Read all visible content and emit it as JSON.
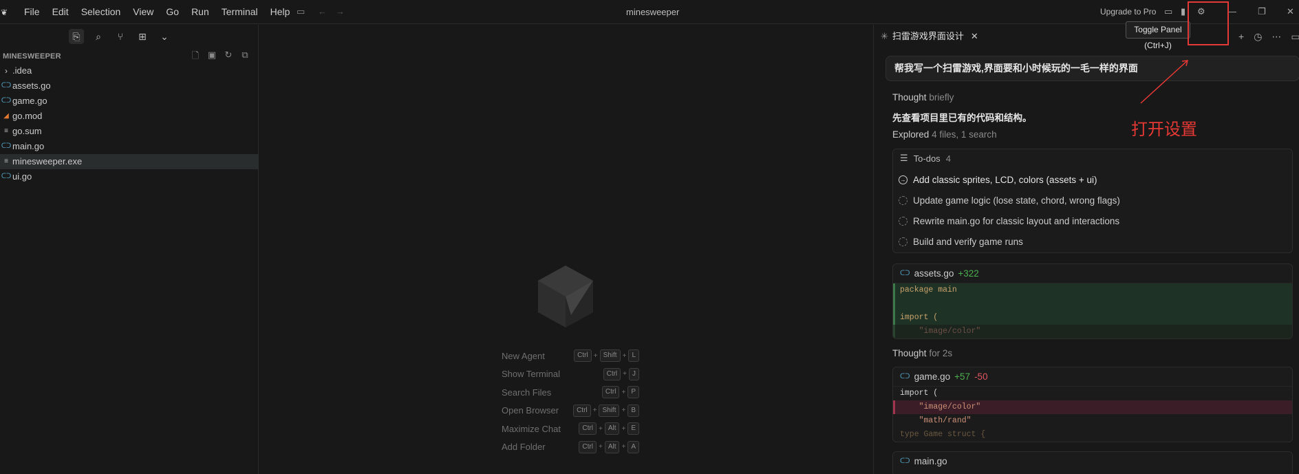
{
  "window_title": "minesweeper",
  "menu": [
    "File",
    "Edit",
    "Selection",
    "View",
    "Go",
    "Run",
    "Terminal",
    "Help"
  ],
  "upgrade_label": "Upgrade to Pro",
  "tooltip": "Toggle Panel (Ctrl+J)",
  "annotation_label": "打开设置",
  "explorer": {
    "title": "MINESWEEPER",
    "files": [
      {
        "name": ".idea",
        "icon": "chevron-right-icon"
      },
      {
        "name": "assets.go",
        "icon": "go-file-icon"
      },
      {
        "name": "game.go",
        "icon": "go-file-icon"
      },
      {
        "name": "go.mod",
        "icon": "go-mod-icon"
      },
      {
        "name": "go.sum",
        "icon": "plain-file-icon"
      },
      {
        "name": "main.go",
        "icon": "go-file-icon"
      },
      {
        "name": "minesweeper.exe",
        "icon": "plain-file-icon",
        "selected": true
      },
      {
        "name": "ui.go",
        "icon": "go-file-icon"
      }
    ]
  },
  "shortcuts": [
    {
      "label": "New Agent",
      "keys": [
        "Ctrl",
        "Shift",
        "L"
      ]
    },
    {
      "label": "Show Terminal",
      "keys": [
        "Ctrl",
        "J"
      ]
    },
    {
      "label": "Search Files",
      "keys": [
        "Ctrl",
        "P"
      ]
    },
    {
      "label": "Open Browser",
      "keys": [
        "Ctrl",
        "Shift",
        "B"
      ]
    },
    {
      "label": "Maximize Chat",
      "keys": [
        "Ctrl",
        "Alt",
        "E"
      ]
    },
    {
      "label": "Add Folder",
      "keys": [
        "Ctrl",
        "Alt",
        "A"
      ]
    }
  ],
  "chat": {
    "tab_title": "扫雷游戏界面设计",
    "prompt": "帮我写一个扫雷游戏,界面要和小时候玩的一毛一样的界面",
    "thought1_label": "Thought",
    "thought1_suffix": "briefly",
    "summary": "先查看项目里已有的代码和结构。",
    "explored_label": "Explored",
    "explored_suffix": "4 files, 1 search",
    "todos_label": "To-dos",
    "todos_count": "4",
    "todos": [
      "Add classic sprites, LCD, colors (assets + ui)",
      "Update game logic (lose state, chord, wrong flags)",
      "Rewrite main.go for classic layout and interactions",
      "Build and verify game runs"
    ],
    "file1": {
      "name": "assets.go",
      "added": "+322"
    },
    "file1_code": {
      "l1_kw": "package",
      "l1_name": "main",
      "l3": "import (",
      "l4": "\"image/color\""
    },
    "thought2_label": "Thought",
    "thought2_suffix": "for 2s",
    "file2": {
      "name": "game.go",
      "added": "+57",
      "removed": "-50"
    },
    "file2_code": {
      "l1": "import (",
      "l2": "\"image/color\"",
      "l3": "\"math/rand\"",
      "l4": "type Game struct {"
    },
    "file3": {
      "name": "main.go"
    }
  }
}
